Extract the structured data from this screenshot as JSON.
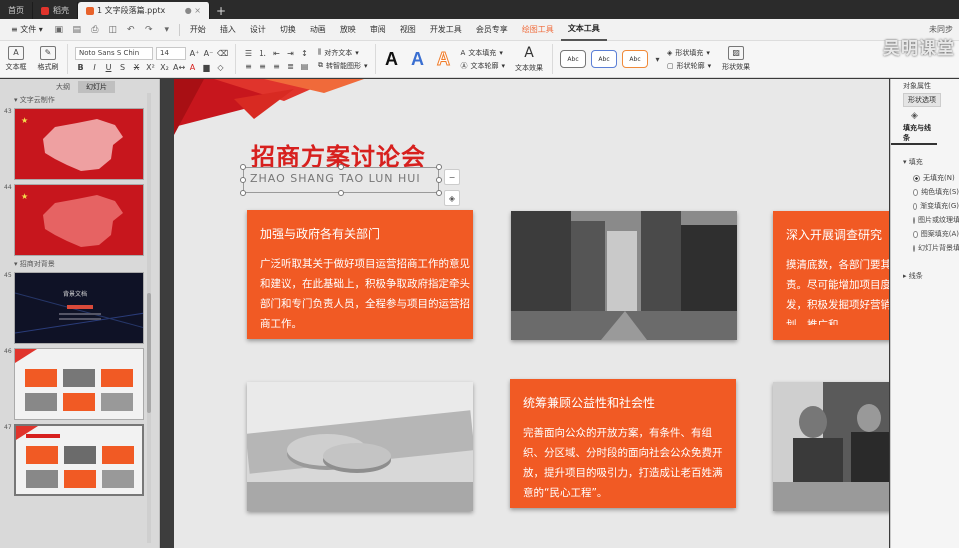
{
  "tabs": {
    "home": "首页",
    "store": "稻壳",
    "doc": "1 文字段落篇.pptx"
  },
  "menu": {
    "file": "文件",
    "items": [
      "开始",
      "插入",
      "设计",
      "切换",
      "动画",
      "放映",
      "审阅",
      "视图",
      "开发工具",
      "会员专享"
    ],
    "draw_tool": "绘图工具",
    "text_tool": "文本工具",
    "right": "未同步"
  },
  "ribbon": {
    "textbox": "文本框",
    "format_painter": "格式刷",
    "font_name": "Noto Sans S Chin",
    "font_size": "14",
    "align_text": "对齐文本",
    "smart_art": "转智能图形",
    "text_fill": "文本填充",
    "text_outline": "文本轮廓",
    "text_effect": "文本效果",
    "style_abc": "Abc",
    "shape_fill": "形状填充",
    "shape_outline": "形状轮廓",
    "shape_effect": "形状效果"
  },
  "watermark": "吴明课堂",
  "left_panel": {
    "tab_outline": "大纲",
    "tab_slides": "幻灯片",
    "section1": "文字云制作",
    "section2": "招商对背景",
    "slide_nums": [
      "43",
      "44",
      "45",
      "46",
      "47"
    ],
    "dark_title": "背景文档"
  },
  "slide": {
    "title": "招商方案讨论会",
    "subtitle": "ZHAO SHANG TAO LUN HUI",
    "card1": {
      "title": "加强与政府各有关部门",
      "body": "广泛听取其关于做好项目运营招商工作的意见和建议，在此基础上，积极争取政府指定牵头部门和专门负责人员，全程参与项目的运营招商工作。"
    },
    "card2": {
      "title": "深入开展调查研究",
      "body": "摸清底数，各部门要其责。尽可能增加项目度出发，积极发掘项好营销策划、推广和"
    },
    "card3": {
      "title": "统筹兼顾公益性和社会性",
      "body": "完善面向公众的开放方案，有条件、有组织、分区域、分时段的面向社会公众免费开放，提升项目的吸引力，打造成让老百姓满意的“民心工程”。"
    }
  },
  "right_panel": {
    "title": "对象属性",
    "tab": "形状选项",
    "sub": "填充与线条",
    "fill_head": "填充",
    "options": [
      "无填充(N)",
      "纯色填充(S)",
      "渐变填充(G)",
      "图片或纹理填充",
      "图案填充(A)",
      "幻灯片背景填充"
    ],
    "line_head": "线条"
  },
  "colors": {
    "accent_red": "#d7201e",
    "card_orange": "#f15a24"
  }
}
